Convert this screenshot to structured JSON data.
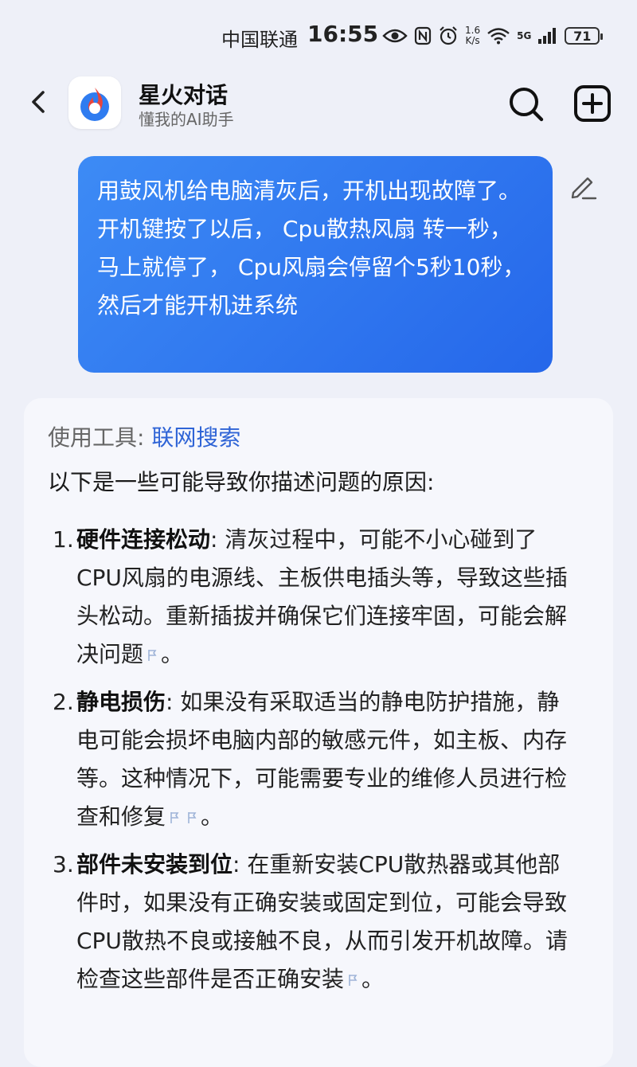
{
  "status_bar": {
    "carrier": "中国联通",
    "time": "16:55",
    "speed_value": "1.6",
    "speed_unit": "K/s",
    "network": "5G",
    "battery": "71"
  },
  "header": {
    "title": "星火对话",
    "subtitle": "懂我的AI助手",
    "icons": [
      "back-arrow-icon",
      "app-logo-icon",
      "search-icon",
      "add-chat-icon"
    ]
  },
  "user_message": {
    "line1": "用鼓风机给电脑清灰后，开机出现故障了。",
    "line2": "开机键按了以后， Cpu散热风扇 转一秒，马上就停了， Cpu风扇会停留个5秒10秒，然后才能开机进系统"
  },
  "ai_message": {
    "tool_label": "使用工具:",
    "tool_name": "联网搜索",
    "intro": "以下是一些可能导致你描述问题的原因:",
    "items": [
      {
        "num": "1.",
        "title": "硬件连接松动",
        "text": ": 清灰过程中，可能不小心碰到了CPU风扇的电源线、主板供电插头等，导致这些插头松动。重新插拔并确保它们连接牢固，可能会解决问题",
        "end": "。"
      },
      {
        "num": "2.",
        "title": "静电损伤",
        "text": ": 如果没有采取适当的静电防护措施，静电可能会损坏电脑内部的敏感元件，如主板、内存等。这种情况下，可能需要专业的维修人员进行检查和修复",
        "end": "。"
      },
      {
        "num": "3.",
        "title": "部件未安装到位",
        "text": ": 在重新安装CPU散热器或其他部件时，如果没有正确安装或固定到位，可能会导致CPU散热不良或接触不良，从而引发开机故障。请检查这些部件是否正确安装",
        "end": "。"
      }
    ]
  },
  "colors": {
    "bubble_start": "#3d8bf5",
    "bubble_end": "#2567ea",
    "link": "#2f64d6",
    "background": "#eef0f8"
  }
}
